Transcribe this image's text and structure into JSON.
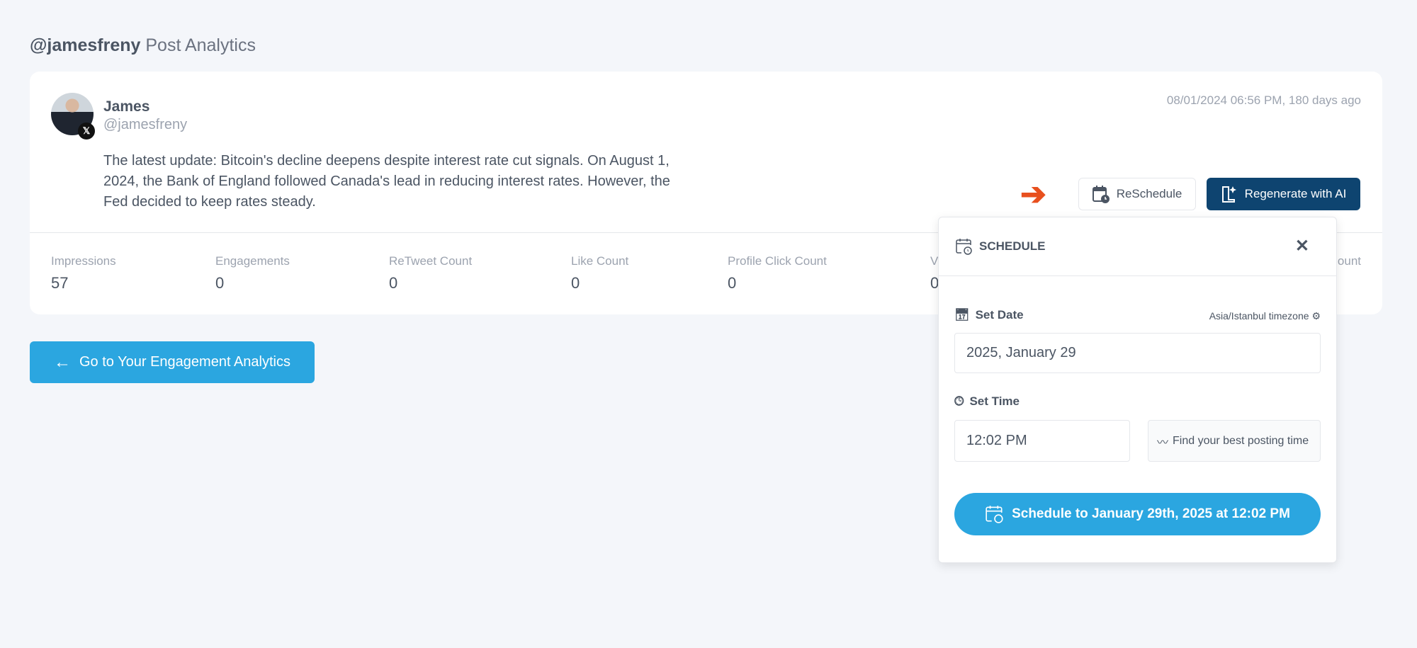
{
  "header": {
    "handle": "@jamesfreny",
    "title": "Post Analytics"
  },
  "post": {
    "author_name": "James",
    "author_handle": "@jamesfreny",
    "platform_badge": "𝕏",
    "timestamp": "08/01/2024 06:56 PM, 180 days ago",
    "text": "The latest update: Bitcoin's decline deepens despite interest rate cut signals. On August 1, 2024, the Bank of England followed Canada's lead in reducing interest rates. However, the Fed decided to keep rates steady.",
    "stats": [
      {
        "label": "Impressions",
        "value": "57"
      },
      {
        "label": "Engagements",
        "value": "0"
      },
      {
        "label": "ReTweet Count",
        "value": "0"
      },
      {
        "label": "Like Count",
        "value": "0"
      },
      {
        "label": "Profile Click Count",
        "value": "0"
      },
      {
        "label": "V",
        "value": "0"
      },
      {
        "label": "ount",
        "value": ""
      }
    ],
    "reschedule_label": "ReSchedule",
    "regenerate_label": "Regenerate with AI"
  },
  "back_button": {
    "label": "Go to Your Engagement Analytics"
  },
  "schedule_popup": {
    "title": "SCHEDULE",
    "close": "✕",
    "set_date_label": "Set Date",
    "timezone": "Asia/Istanbul timezone",
    "date_value": "2025, January 29",
    "set_time_label": "Set Time",
    "time_value": "12:02 PM",
    "best_time_label": "Find your best posting time",
    "submit_label": "Schedule to January 29th, 2025 at 12:02 PM"
  },
  "colors": {
    "primary": "#2ba6e0",
    "dark": "#0e4470",
    "arrow": "#e8501e",
    "background": "#f4f6fa"
  }
}
